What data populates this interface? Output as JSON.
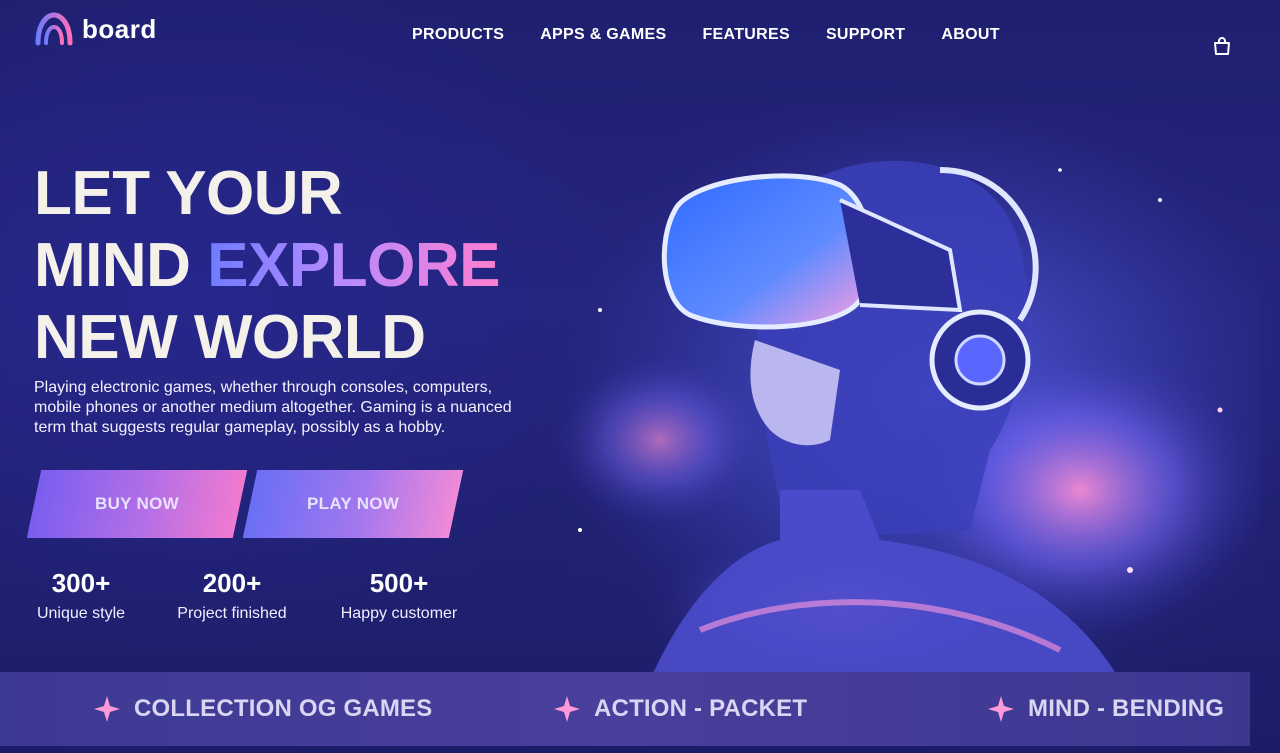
{
  "brand": {
    "name": "board",
    "logo_icon": "arch-logo-icon"
  },
  "nav": {
    "items": [
      {
        "label": "PRODUCTS"
      },
      {
        "label": "APPS & GAMES"
      },
      {
        "label": "FEATURES"
      },
      {
        "label": "SUPPORT"
      },
      {
        "label": "ABOUT"
      }
    ],
    "cart_icon": "shopping-bag-icon"
  },
  "hero": {
    "headline_line1": "LET YOUR",
    "headline_line2_prefix": "MIND ",
    "headline_line2_accent": "EXPLORE",
    "headline_line3": "NEW WORLD",
    "description": "Playing electronic games, whether through consoles, computers, mobile phones or another medium altogether. Gaming is a nuanced term that suggests regular gameplay, possibly as a hobby.",
    "buttons": {
      "buy": "BUY NOW",
      "play": "PLAY NOW"
    },
    "stats": [
      {
        "value": "300+",
        "label": "Unique style"
      },
      {
        "value": "200+",
        "label": "Project finished"
      },
      {
        "value": "500+",
        "label": "Happy customer"
      }
    ],
    "image": "vr-headset-girl-illustration"
  },
  "ticker": {
    "items": [
      {
        "label": "COLLECTION OG GAMES"
      },
      {
        "label": "ACTION - PACKET"
      },
      {
        "label": "MIND - BENDING"
      }
    ],
    "icon": "sparkle-star-icon"
  },
  "colors": {
    "background": "#1f2070",
    "accent_start": "#6f7bff",
    "accent_end": "#ff7ed0",
    "ticker_bg": "#4a3f9c"
  }
}
